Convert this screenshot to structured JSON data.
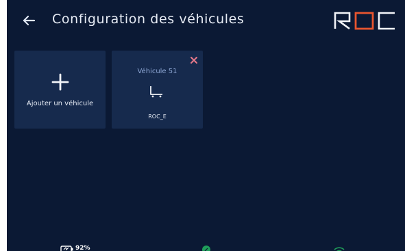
{
  "header": {
    "title": "Configuration des véhicules",
    "back_icon": "arrow-left-icon",
    "logo_text": "ROC",
    "logo_accent_color": "#e8552f"
  },
  "cards": {
    "add": {
      "icon": "plus-icon",
      "label": "Ajouter un véhicule"
    },
    "vehicle": {
      "name": "Véhicule 51",
      "model": "ROC_E",
      "icon": "cart-icon",
      "close_icon": "close-icon",
      "close_color": "#e87a8a"
    }
  },
  "status_bar": {
    "battery": "92%",
    "battery_icon": "battery-icon",
    "signal_icon": "signal-icon",
    "wifi_icon": "wifi-icon",
    "ok_color": "#1f9e5a"
  },
  "colors": {
    "background": "#0b1934",
    "card": "#162a4d",
    "text": "#e6ebf4",
    "muted": "#8fa8d6"
  }
}
